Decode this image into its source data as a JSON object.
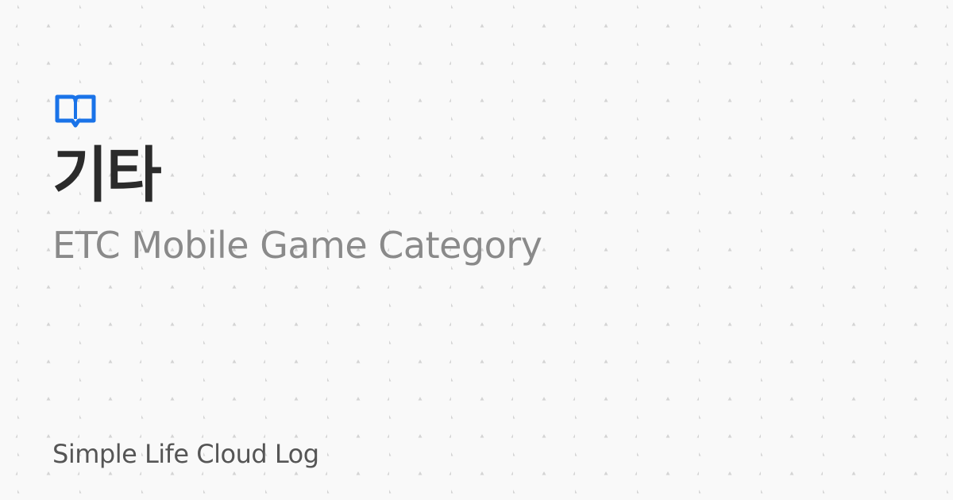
{
  "page": {
    "title": "기타",
    "subtitle": "ETC Mobile Game Category",
    "footer": "Simple Life Cloud Log",
    "icon": "book-open-icon"
  },
  "colors": {
    "accent": "#1a73e8",
    "title": "#2b2b2b",
    "subtitle": "#8a8a8a",
    "footer": "#555555",
    "background": "#f9f9f9",
    "pattern": "#d4d4d4"
  }
}
